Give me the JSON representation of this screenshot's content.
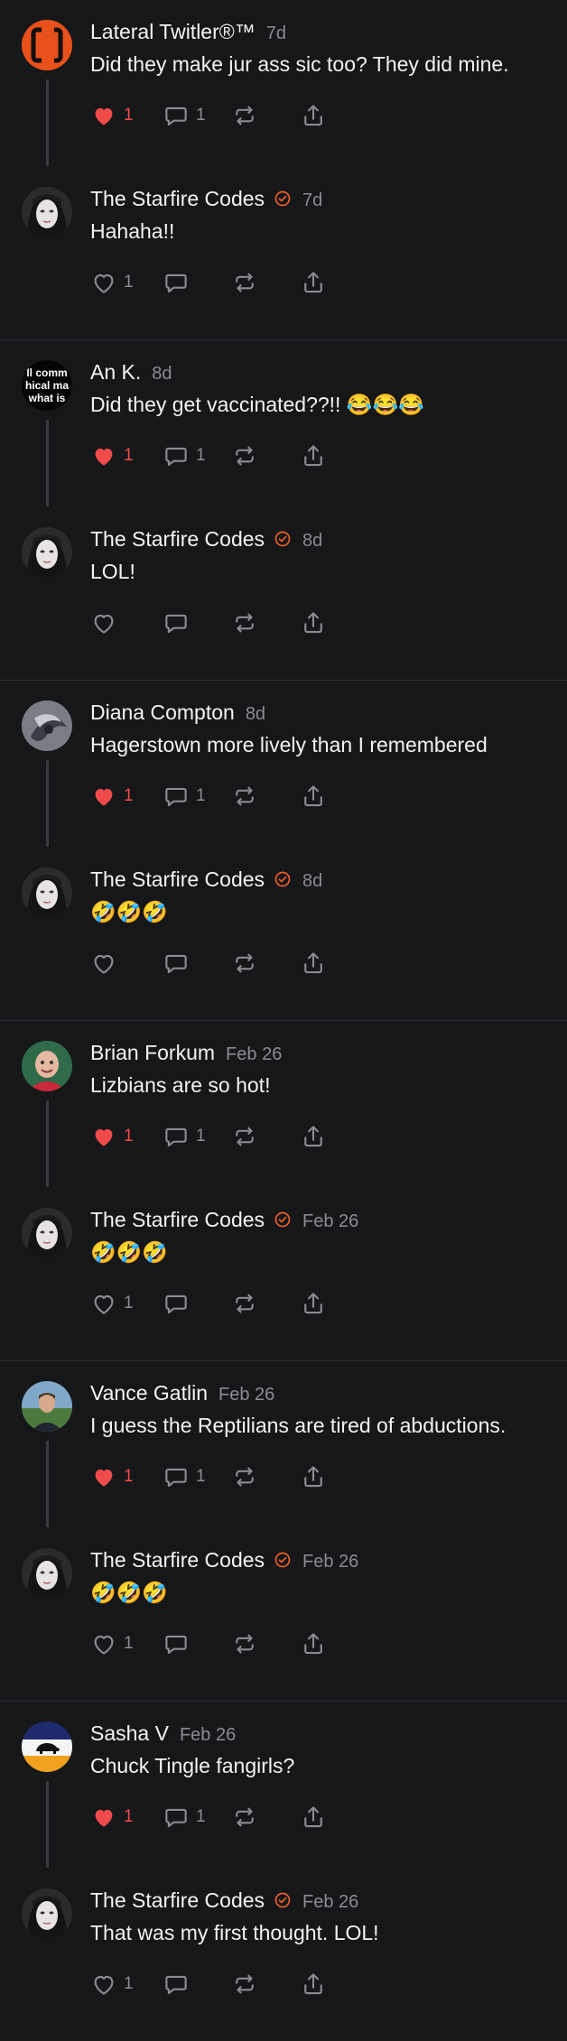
{
  "colors": {
    "background": "#161719",
    "like_red": "#ef4b4b",
    "verified_orange": "#f0612a",
    "muted": "#8b8c90"
  },
  "threads": [
    {
      "parent": {
        "name": "Lateral Twitler®™",
        "time": "7d",
        "text": "Did they make jur ass sic too? They did mine.",
        "verified": false,
        "liked": true,
        "likes": "1",
        "replies": "1",
        "avatar": "lateral-logo"
      },
      "reply": {
        "name": "The Starfire Codes",
        "time": "7d",
        "text": "Hahaha!!",
        "verified": true,
        "liked": false,
        "likes": "1",
        "replies": "",
        "avatar": "starfire-face"
      }
    },
    {
      "parent": {
        "name": "An K.",
        "time": "8d",
        "text": "Did they get vaccinated??!! 😂😂😂",
        "verified": false,
        "liked": true,
        "likes": "1",
        "replies": "1",
        "avatar": "text-meme",
        "avatar_text": [
          "ll comm",
          "hical ma",
          "what is"
        ]
      },
      "reply": {
        "name": "The Starfire Codes",
        "time": "8d",
        "text": "LOL!",
        "verified": true,
        "liked": false,
        "likes": "",
        "replies": "",
        "avatar": "starfire-face"
      }
    },
    {
      "parent": {
        "name": "Diana Compton",
        "time": "8d",
        "text": "Hagerstown more lively than I remembered",
        "verified": false,
        "liked": true,
        "likes": "1",
        "replies": "1",
        "avatar": "swirl"
      },
      "reply": {
        "name": "The Starfire Codes",
        "time": "8d",
        "text": "🤣🤣🤣",
        "verified": true,
        "liked": false,
        "likes": "",
        "replies": "",
        "avatar": "starfire-face"
      }
    },
    {
      "parent": {
        "name": "Brian Forkum",
        "time": "Feb 26",
        "text": "Lizbians are so hot!",
        "verified": false,
        "liked": true,
        "likes": "1",
        "replies": "1",
        "avatar": "bald-man"
      },
      "reply": {
        "name": "The Starfire Codes",
        "time": "Feb 26",
        "text": "🤣🤣🤣",
        "verified": true,
        "liked": false,
        "likes": "1",
        "replies": "",
        "avatar": "starfire-face"
      }
    },
    {
      "parent": {
        "name": "Vance Gatlin",
        "time": "Feb 26",
        "text": "I guess the Reptilians are tired of abductions.",
        "verified": false,
        "liked": true,
        "likes": "1",
        "replies": "1",
        "avatar": "outdoor-man"
      },
      "reply": {
        "name": "The Starfire Codes",
        "time": "Feb 26",
        "text": "🤣🤣🤣",
        "verified": true,
        "liked": false,
        "likes": "1",
        "replies": "",
        "avatar": "starfire-face"
      }
    },
    {
      "parent": {
        "name": "Sasha V",
        "time": "Feb 26",
        "text": "Chuck Tingle fangirls?",
        "verified": false,
        "liked": true,
        "likes": "1",
        "replies": "1",
        "avatar": "bison-flag"
      },
      "reply": {
        "name": "The Starfire Codes",
        "time": "Feb 26",
        "text": "That was my first thought. LOL!",
        "verified": true,
        "liked": false,
        "likes": "1",
        "replies": "",
        "avatar": "starfire-face"
      }
    }
  ]
}
